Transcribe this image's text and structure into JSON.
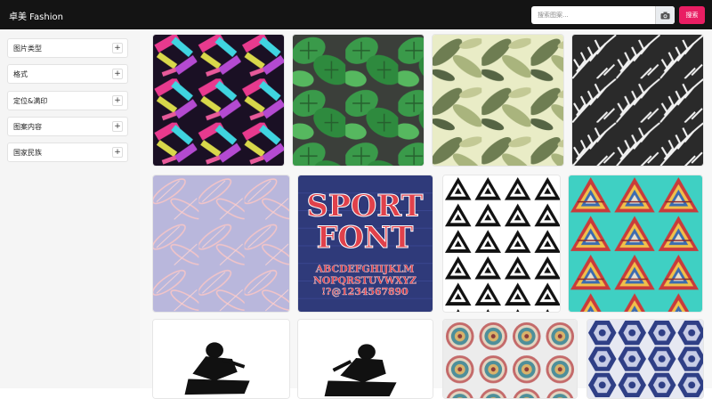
{
  "header": {
    "brand": "卓美 Fashion",
    "search_placeholder": "搜索图案...",
    "search_button": "搜索",
    "camera_icon": "camera-icon"
  },
  "sidebar": {
    "filters": [
      {
        "label": "图片类型"
      },
      {
        "label": "格式"
      },
      {
        "label": "定位&满印"
      },
      {
        "label": "图案内容"
      },
      {
        "label": "国家民族"
      }
    ],
    "expand_symbol": "+"
  },
  "tiles": {
    "sport_font": {
      "line1": "SPORT",
      "line2": "FONT",
      "row1": "ABCDEFGHIJKLM",
      "row2": "NOPQRSTUVWXYZ",
      "row3": "!?@1234567890"
    }
  },
  "colors": {
    "topbar": "#141414",
    "accent": "#e91e63",
    "sidebar_bg": "#f5f5f5"
  }
}
